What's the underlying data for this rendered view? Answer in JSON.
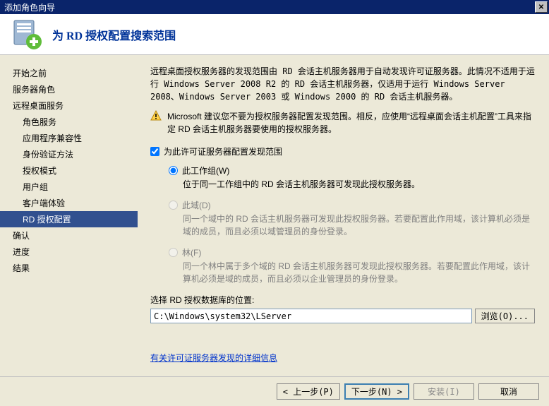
{
  "window": {
    "title": "添加角色向导"
  },
  "header": {
    "title": "为 RD 授权配置搜索范围"
  },
  "sidebar": {
    "items": [
      {
        "label": "开始之前",
        "sub": false
      },
      {
        "label": "服务器角色",
        "sub": false
      },
      {
        "label": "远程桌面服务",
        "sub": false
      },
      {
        "label": "角色服务",
        "sub": true
      },
      {
        "label": "应用程序兼容性",
        "sub": true
      },
      {
        "label": "身份验证方法",
        "sub": true
      },
      {
        "label": "授权模式",
        "sub": true
      },
      {
        "label": "用户组",
        "sub": true
      },
      {
        "label": "客户端体验",
        "sub": true
      },
      {
        "label": "RD 授权配置",
        "sub": true,
        "selected": true
      },
      {
        "label": "确认",
        "sub": false
      },
      {
        "label": "进度",
        "sub": false
      },
      {
        "label": "结果",
        "sub": false
      }
    ]
  },
  "content": {
    "intro": "远程桌面授权服务器的发现范围由 RD 会话主机服务器用于自动发现许可证服务器。此情况不适用于运行 Windows Server 2008 R2 的 RD 会话主机服务器，仅适用于运行 Windows Server 2008、Windows Server 2003 或 Windows 2000 的 RD 会话主机服务器。",
    "warning": "Microsoft 建议您不要为授权服务器配置发现范围。相反，应使用“远程桌面会话主机配置”工具来指定 RD 会话主机服务器要使用的授权服务器。",
    "checkbox_label": "为此许可证服务器配置发现范围",
    "radios": {
      "workgroup": {
        "label": "此工作组(W)",
        "desc": "位于同一工作组中的 RD 会话主机服务器可发现此授权服务器。"
      },
      "domain": {
        "label": "此域(D)",
        "desc": "同一个域中的 RD 会话主机服务器可发现此授权服务器。若要配置此作用域，该计算机必须是域的成员，而且必须以域管理员的身份登录。"
      },
      "forest": {
        "label": "林(F)",
        "desc": "同一个林中属于多个域的 RD 会话主机服务器可发现此授权服务器。若要配置此作用域，该计算机必须是域的成员，而且必须以企业管理员的身份登录。"
      }
    },
    "db_label": "选择 RD 授权数据库的位置:",
    "db_path": "C:\\Windows\\system32\\LServer",
    "browse_label": "浏览(O)...",
    "link": "有关许可证服务器发现的详细信息"
  },
  "footer": {
    "prev": "< 上一步(P)",
    "next": "下一步(N) >",
    "install": "安装(I)",
    "cancel": "取消"
  }
}
